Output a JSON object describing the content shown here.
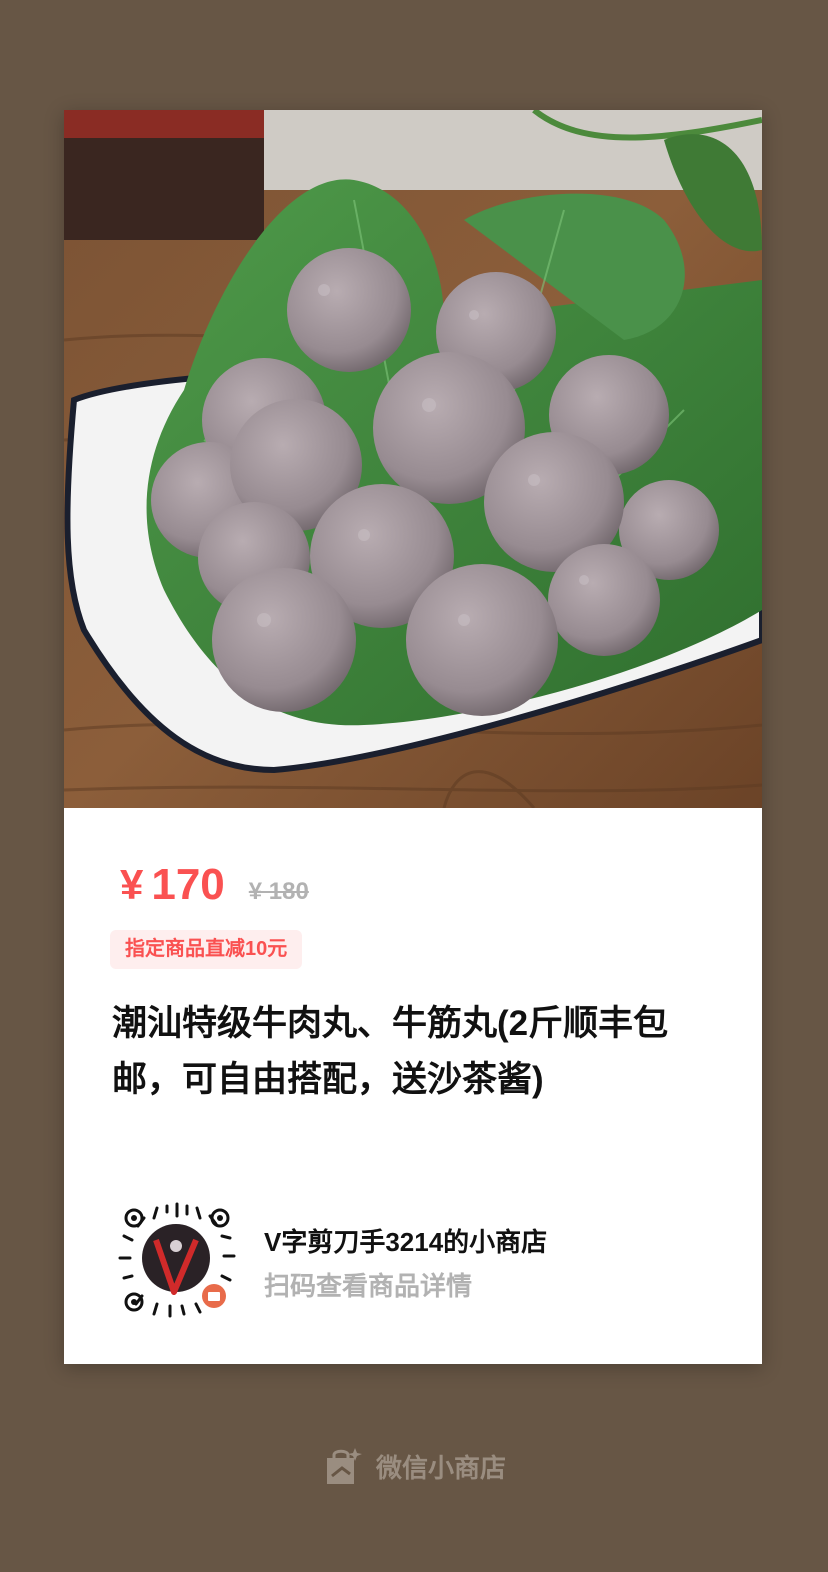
{
  "product": {
    "currency_symbol": "¥",
    "price": "170",
    "original_price": "¥ 180",
    "promo_tag": "指定商品直减10元",
    "title": "潮汕特级牛肉丸、牛筋丸(2斤顺丰包邮，可自由搭配，送沙茶酱)",
    "image_icon": "beef-balls-photo"
  },
  "shop": {
    "name": "V字剪刀手3214的小商店",
    "hint": "扫码查看商品详情",
    "qr_icon": "mini-program-qr-code"
  },
  "footer": {
    "label": "微信小商店",
    "icon": "shopping-bag-icon"
  },
  "colors": {
    "background": "#675645",
    "accent": "#fa5151",
    "muted": "#b2b2b2"
  }
}
